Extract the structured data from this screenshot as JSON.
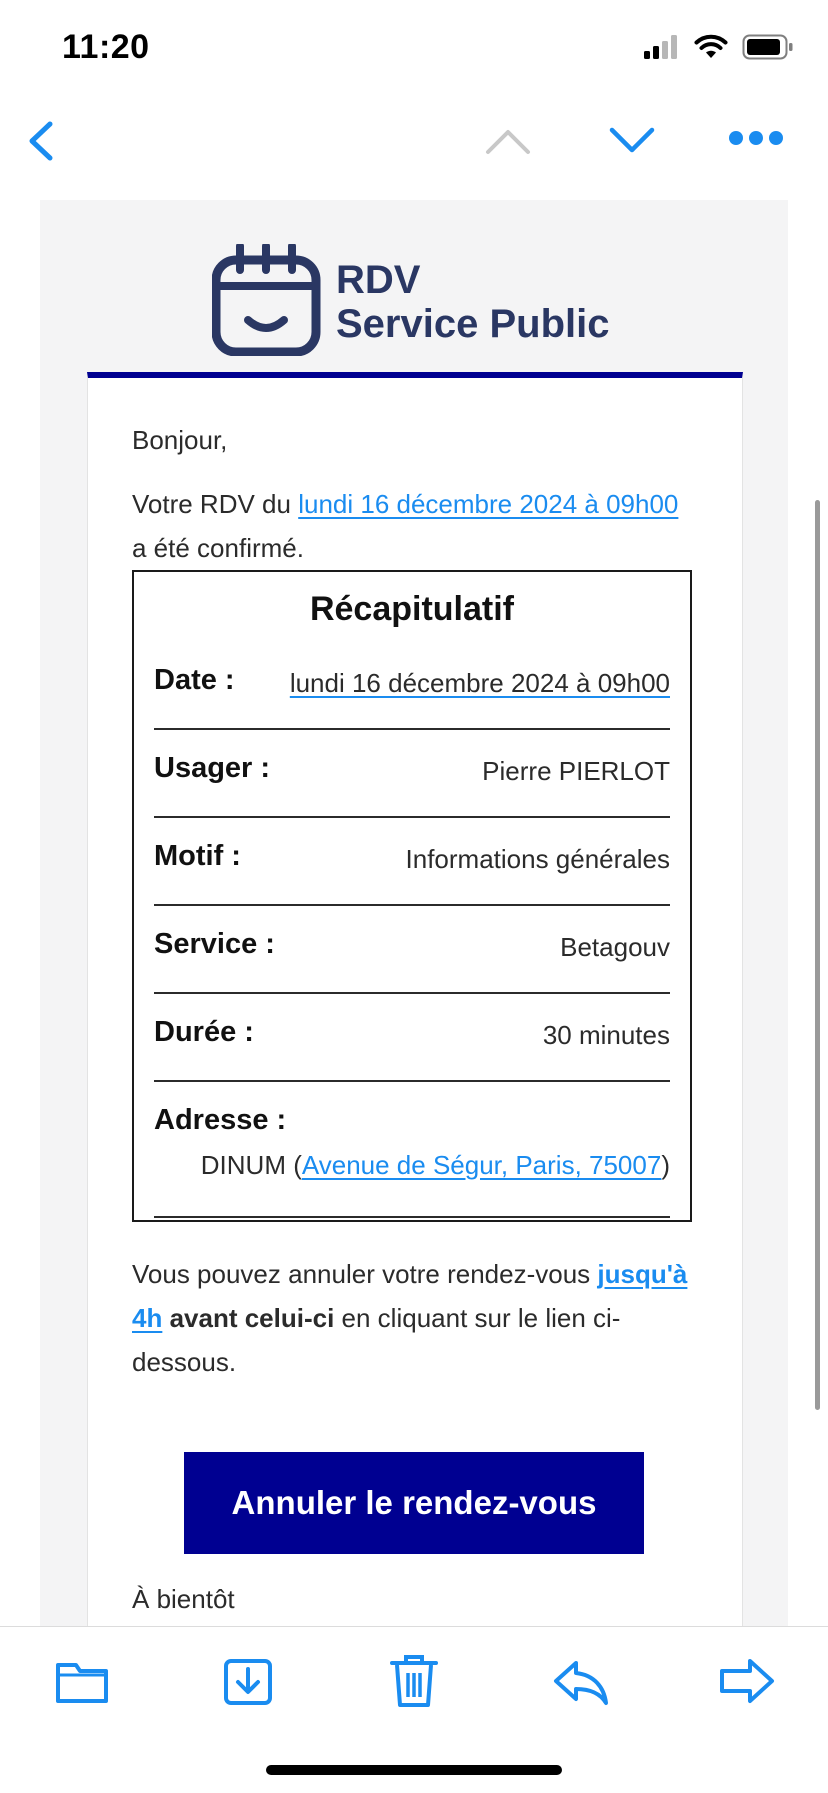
{
  "status": {
    "time": "11:20"
  },
  "nav": {
    "back_icon": "chevron-left-icon",
    "prev_icon": "chevron-up-icon",
    "next_icon": "chevron-down-icon",
    "more_icon": "ellipsis-icon"
  },
  "logo": {
    "line1": "RDV",
    "line2": "Service Public"
  },
  "email": {
    "greeting": "Bonjour,",
    "intro_prefix": "Votre RDV du ",
    "intro_link": "lundi 16 décembre 2024 à 09h00",
    "intro_suffix": " a été confirmé.",
    "summary": {
      "title": "Récapitulatif",
      "rows": [
        {
          "label": "Date :",
          "value": "lundi 16 décembre 2024 à 09h00"
        },
        {
          "label": "Usager :",
          "value": "Pierre PIERLOT"
        },
        {
          "label": "Motif :",
          "value": "Informations générales"
        },
        {
          "label": "Service :",
          "value": "Betagouv"
        },
        {
          "label": "Durée :",
          "value": "30 minutes"
        }
      ],
      "address": {
        "label": "Adresse :",
        "place": "DINUM (",
        "link": "Avenue de Ségur, Paris, 75007",
        "close": ")"
      }
    },
    "cancel": {
      "text_prefix": "Vous pouvez annuler votre rendez-vous ",
      "text_link": "jusqu'à 4h",
      "text_bold": " avant celui-ci",
      "text_suffix": " en cliquant sur le lien ci-dessous."
    },
    "cancel_button": "Annuler le rendez-vous",
    "farewell": "À bientôt"
  },
  "toolbar": {
    "folder_icon": "folder-icon",
    "archive_icon": "archive-icon",
    "trash_icon": "trash-icon",
    "reply_icon": "reply-icon",
    "forward_icon": "forward-icon"
  },
  "colors": {
    "accent": "#1a8cf0",
    "brand": "#000091",
    "logo": "#2a3763"
  }
}
